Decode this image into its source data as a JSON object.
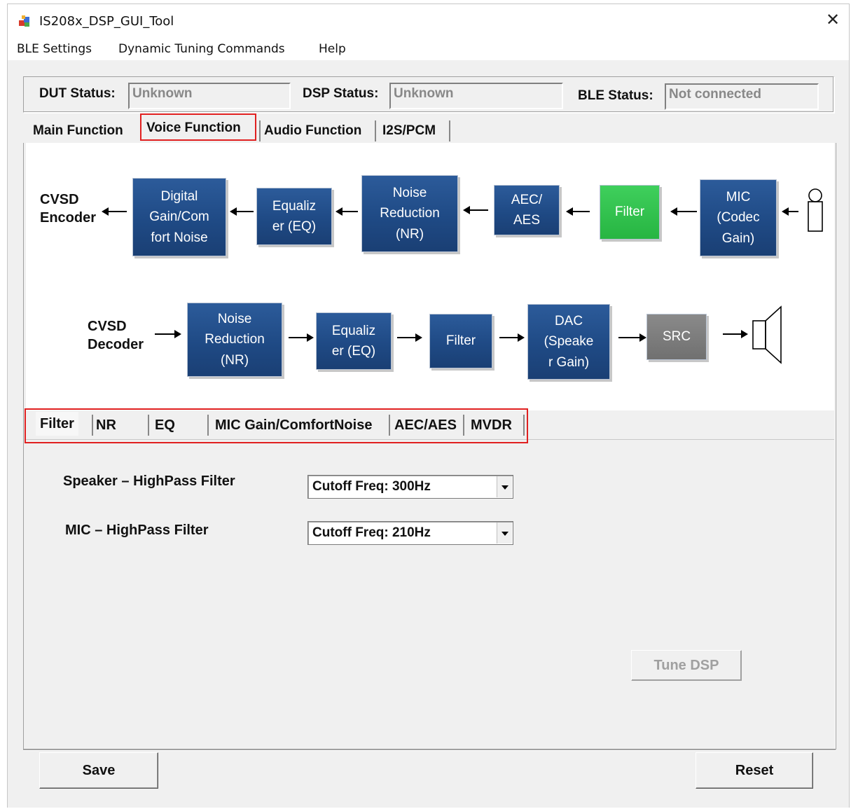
{
  "window": {
    "title": "IS208x_DSP_GUI_Tool",
    "close_glyph": "✕"
  },
  "menu": [
    "BLE Settings",
    "Dynamic Tuning Commands",
    "Help"
  ],
  "status": {
    "dut_label": "DUT Status:",
    "dut_value": "Unknown",
    "dsp_label": "DSP Status:",
    "dsp_value": "Unknown",
    "ble_label": "BLE Status:",
    "ble_value": "Not connected"
  },
  "main_tabs": [
    "Main Function",
    "Voice Function",
    "Audio Function",
    "I2S/PCM"
  ],
  "main_tab_selected": "Voice Function",
  "diagram": {
    "encoder_label": [
      "CVSD",
      "Encoder"
    ],
    "decoder_label": [
      "CVSD",
      "Decoder"
    ],
    "encoder_blocks": [
      {
        "lines": [
          "Digital",
          "Gain/Com",
          "fort Noise"
        ]
      },
      {
        "lines": [
          "Equaliz",
          "er (EQ)"
        ]
      },
      {
        "lines": [
          "Noise",
          "Reduction",
          "(NR)"
        ]
      },
      {
        "lines": [
          "AEC/",
          "AES"
        ]
      },
      {
        "lines": [
          "Filter"
        ]
      },
      {
        "lines": [
          "MIC",
          "(Codec",
          "Gain)"
        ]
      }
    ],
    "decoder_blocks": [
      {
        "lines": [
          "Noise",
          "Reduction",
          "(NR)"
        ]
      },
      {
        "lines": [
          "Equaliz",
          "er (EQ)"
        ]
      },
      {
        "lines": [
          "Filter"
        ]
      },
      {
        "lines": [
          "DAC",
          "(Speake",
          "r Gain)"
        ]
      },
      {
        "lines": [
          "SRC"
        ]
      }
    ],
    "colors": {
      "block": "#1f4a85",
      "active": "#27b542",
      "inactive": "#7a7a7a"
    },
    "icons": [
      "microphone-icon",
      "speaker-icon"
    ]
  },
  "sub_tabs": [
    "Filter",
    "NR",
    "EQ",
    "MIC Gain/ComfortNoise",
    "AEC/AES",
    "MVDR"
  ],
  "sub_tab_selected": "Filter",
  "filter": {
    "speaker_label": "Speaker – HighPass Filter",
    "speaker_value": "Cutoff Freq: 300Hz",
    "mic_label": "MIC – HighPass Filter",
    "mic_value": "Cutoff Freq: 210Hz"
  },
  "buttons": {
    "tune": "Tune DSP",
    "save": "Save",
    "reset": "Reset"
  },
  "highlight_color": "#e02020"
}
